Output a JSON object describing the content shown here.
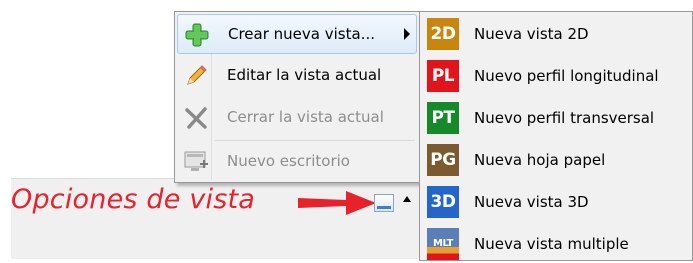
{
  "annotation": {
    "text": "Opciones de vista",
    "color": "#e8222a"
  },
  "menu": {
    "items": [
      {
        "label": "Crear nueva vista...",
        "icon": "green-plus-icon",
        "state": "highlighted",
        "has_submenu": true
      },
      {
        "label": "Editar la vista actual",
        "icon": "pencil-icon",
        "state": "enabled",
        "has_submenu": false
      },
      {
        "label": "Cerrar la vista actual",
        "icon": "close-x-icon",
        "state": "disabled",
        "has_submenu": false
      },
      {
        "label": "Nuevo escritorio",
        "icon": "new-desktop-icon",
        "state": "disabled",
        "has_submenu": false
      }
    ]
  },
  "submenu": {
    "items": [
      {
        "badge": "2D",
        "badge_color": "#c8860e",
        "label": "Nueva vista 2D"
      },
      {
        "badge": "PL",
        "badge_color": "#e1141c",
        "label": "Nuevo perfil longitudinal"
      },
      {
        "badge": "PT",
        "badge_color": "#168a2a",
        "label": "Nuevo perfil transversal"
      },
      {
        "badge": "PG",
        "badge_color": "#7a5a2e",
        "label": "Nueva hoja papel"
      },
      {
        "badge": "3D",
        "badge_color": "#2466c8",
        "label": "Nueva vista 3D"
      },
      {
        "badge": "MLT",
        "badge_color": "#5a7fb8",
        "label": "Nueva vista multiple"
      }
    ]
  },
  "taskbar": {
    "tray_icon": "view-options-icon",
    "overflow_icon": "tray-up-arrow-icon"
  }
}
